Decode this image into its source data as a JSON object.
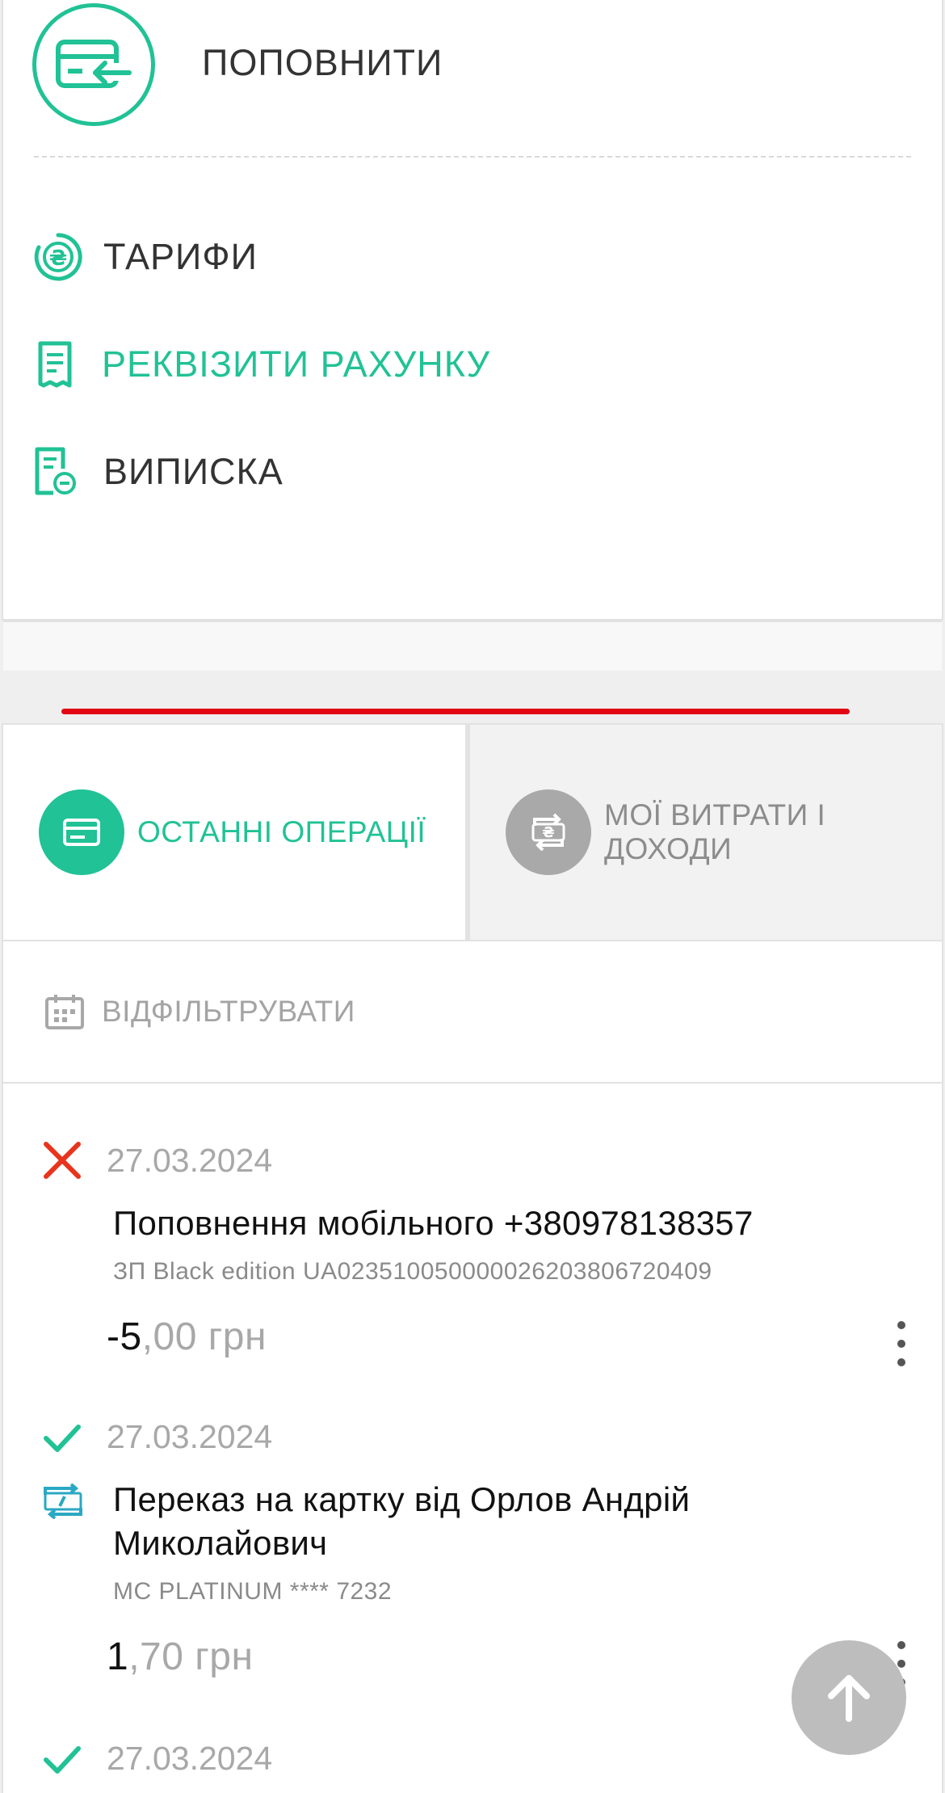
{
  "menu": {
    "topup_label": "ПОПОВНИТИ",
    "items": [
      {
        "label": "ТАРИФИ",
        "icon": "hryvnia-circle-icon",
        "color": "#333333"
      },
      {
        "label": "РЕКВІЗИТИ РАХУНКУ",
        "icon": "document-icon",
        "color": "#21c295"
      },
      {
        "label": "ВИПИСКА",
        "icon": "statement-icon",
        "color": "#333333"
      }
    ]
  },
  "tabs": {
    "active_label": "ОСТАННІ ОПЕРАЦІЇ",
    "inactive_label": "МОЇ ВИТРАТИ І ДОХОДИ"
  },
  "filter": {
    "label": "ВІДФІЛЬТРУВАТИ"
  },
  "transactions": [
    {
      "status": "failed",
      "date": "27.03.2024",
      "title": "Поповнення мобільного +380978138357",
      "subtitle": "ЗП Black edition UA023510050000026203806720409",
      "amount_int": "-5",
      "amount_frac": ",00 грн"
    },
    {
      "status": "success",
      "date": "27.03.2024",
      "title": "Переказ на картку від Орлов Андрій Миколайович",
      "subtitle": "MC PLATINUM **** 7232",
      "amount_int": "1",
      "amount_frac": ",70 грн"
    },
    {
      "status": "success",
      "date": "27.03.2024"
    }
  ],
  "colors": {
    "accent": "#21c295",
    "error": "#e8341c",
    "red_divider": "#e30613",
    "muted": "#a8a8a8"
  }
}
